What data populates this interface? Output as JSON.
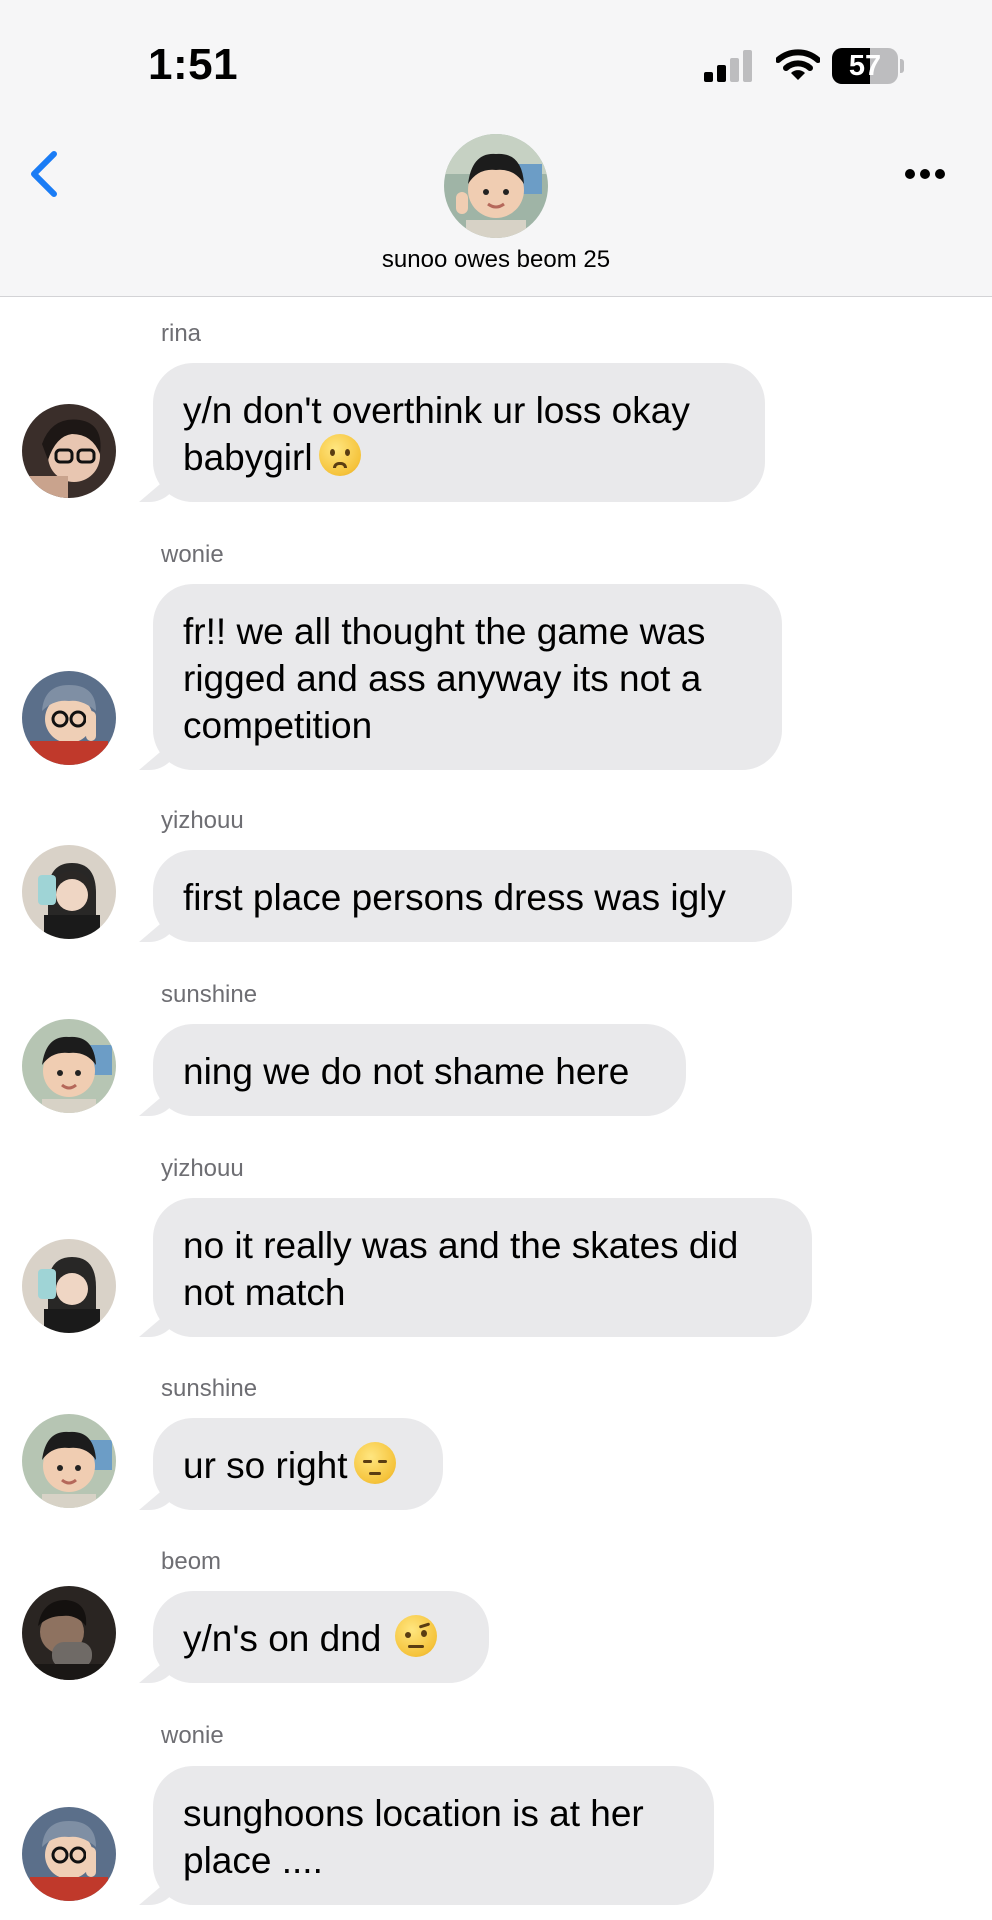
{
  "status_bar": {
    "time": "1:51",
    "signal_icon": "cellular-signal-icon",
    "wifi_icon": "wifi-icon",
    "battery_level": "57"
  },
  "header": {
    "back_icon": "chevron-left-icon",
    "more_icon": "more-horizontal-icon",
    "group_name": "sunoo owes beom 25"
  },
  "colors": {
    "accent": "#1a7cf5",
    "bubble": "#e9e9eb",
    "header_bg": "#f6f6f7",
    "sender_label": "#6e6e73"
  },
  "messages": [
    {
      "sender": "rina",
      "lines": [
        "y/n don't overthink ur loss okay",
        "babygirl"
      ],
      "emoji": "worried-face"
    },
    {
      "sender": "wonie",
      "lines": [
        "fr!! we all thought the game was",
        "rigged and ass anyway its not a",
        "competition"
      ]
    },
    {
      "sender": "yizhouu",
      "lines": [
        "first place persons dress was igly"
      ]
    },
    {
      "sender": "sunshine",
      "lines": [
        "ning we do not shame here"
      ]
    },
    {
      "sender": "yizhouu",
      "lines": [
        "no it really was and the skates did",
        "not match"
      ]
    },
    {
      "sender": "sunshine",
      "lines": [
        "ur so right"
      ],
      "emoji": "pensive-face"
    },
    {
      "sender": "beom",
      "lines": [
        "y/n's on dnd"
      ],
      "emoji": "face-with-raised-eyebrow"
    },
    {
      "sender": "wonie",
      "lines": [
        "sunghoons location is at her",
        "place ...."
      ]
    }
  ]
}
